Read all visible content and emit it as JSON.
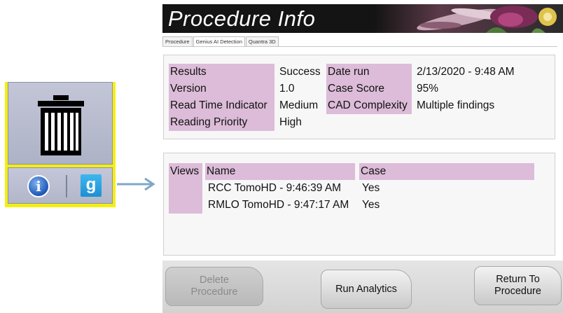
{
  "left_panel": {
    "trash_icon": "trash-icon",
    "info_icon": "info-icon",
    "info_glyph": "i",
    "genius_icon": "genius-ai-icon",
    "genius_glyph": "g",
    "highlight_color": "#f5ef10"
  },
  "dialog": {
    "title": "Procedure Info",
    "tabs": [
      {
        "label": "Procedure",
        "active": false
      },
      {
        "label": "Genius AI Detection",
        "active": true
      },
      {
        "label": "Quantra 3D",
        "active": false
      }
    ],
    "summary": {
      "results_label": "Results",
      "results_value": "Success",
      "version_label": "Version",
      "version_value": "1.0",
      "read_time_label": "Read Time Indicator",
      "read_time_value": "Medium",
      "priority_label": "Reading Priority",
      "priority_value": "High",
      "date_run_label": "Date run",
      "date_run_value": "2/13/2020 - 9:48 AM",
      "case_score_label": "Case Score",
      "case_score_value": "95%",
      "cad_label": "CAD Complexity",
      "cad_value": "Multiple findings"
    },
    "views": {
      "views_label": "Views",
      "name_header": "Name",
      "case_header": "Case",
      "rows": [
        {
          "name": "RCC TomoHD - 9:46:39 AM",
          "case": "Yes"
        },
        {
          "name": "RMLO TomoHD - 9:47:17 AM",
          "case": "Yes"
        }
      ]
    },
    "buttons": {
      "delete": "Delete\nProcedure",
      "run": "Run Analytics",
      "return": "Return To\nProcedure"
    },
    "label_highlight_color": "#dcbcd8"
  }
}
